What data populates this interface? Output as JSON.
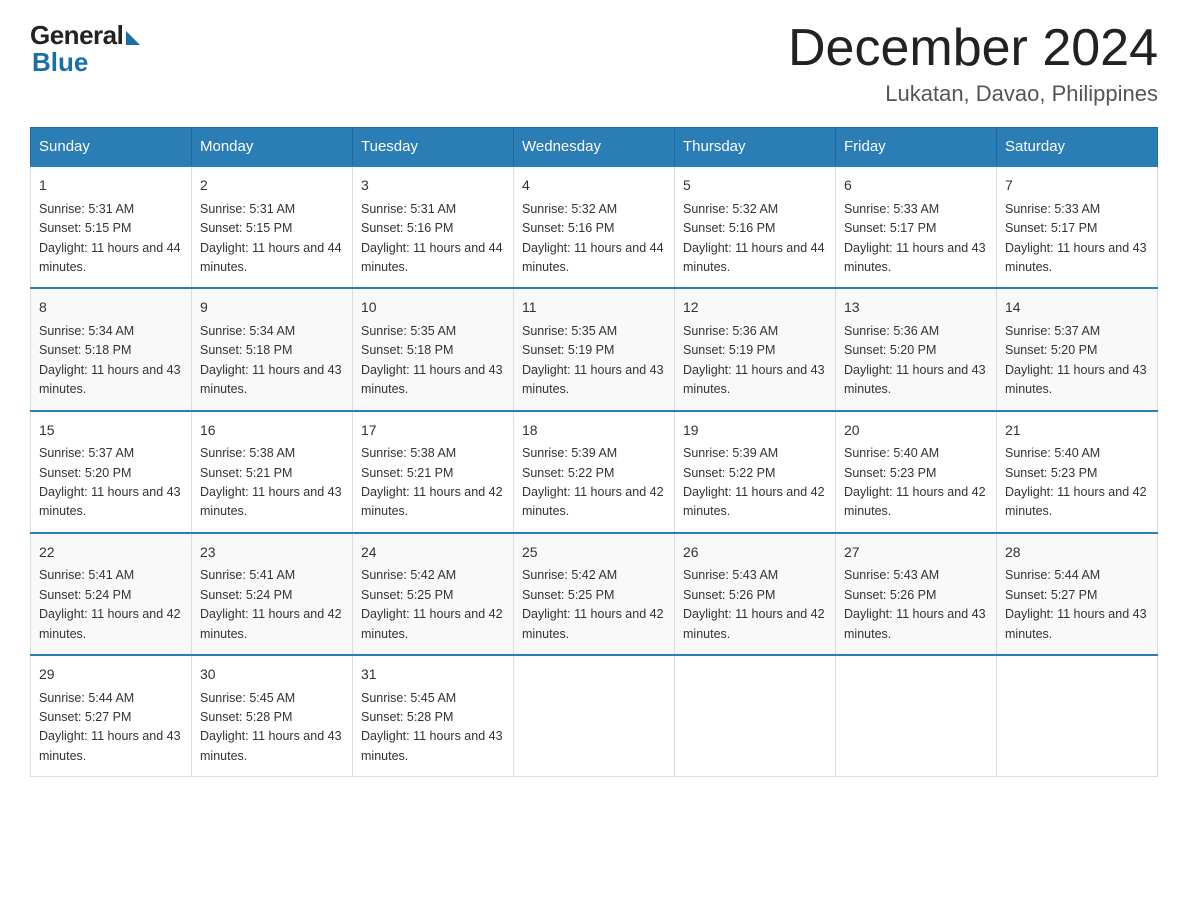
{
  "logo": {
    "general": "General",
    "blue": "Blue"
  },
  "title": "December 2024",
  "subtitle": "Lukatan, Davao, Philippines",
  "headers": [
    "Sunday",
    "Monday",
    "Tuesday",
    "Wednesday",
    "Thursday",
    "Friday",
    "Saturday"
  ],
  "weeks": [
    [
      {
        "day": "1",
        "sunrise": "Sunrise: 5:31 AM",
        "sunset": "Sunset: 5:15 PM",
        "daylight": "Daylight: 11 hours and 44 minutes."
      },
      {
        "day": "2",
        "sunrise": "Sunrise: 5:31 AM",
        "sunset": "Sunset: 5:15 PM",
        "daylight": "Daylight: 11 hours and 44 minutes."
      },
      {
        "day": "3",
        "sunrise": "Sunrise: 5:31 AM",
        "sunset": "Sunset: 5:16 PM",
        "daylight": "Daylight: 11 hours and 44 minutes."
      },
      {
        "day": "4",
        "sunrise": "Sunrise: 5:32 AM",
        "sunset": "Sunset: 5:16 PM",
        "daylight": "Daylight: 11 hours and 44 minutes."
      },
      {
        "day": "5",
        "sunrise": "Sunrise: 5:32 AM",
        "sunset": "Sunset: 5:16 PM",
        "daylight": "Daylight: 11 hours and 44 minutes."
      },
      {
        "day": "6",
        "sunrise": "Sunrise: 5:33 AM",
        "sunset": "Sunset: 5:17 PM",
        "daylight": "Daylight: 11 hours and 43 minutes."
      },
      {
        "day": "7",
        "sunrise": "Sunrise: 5:33 AM",
        "sunset": "Sunset: 5:17 PM",
        "daylight": "Daylight: 11 hours and 43 minutes."
      }
    ],
    [
      {
        "day": "8",
        "sunrise": "Sunrise: 5:34 AM",
        "sunset": "Sunset: 5:18 PM",
        "daylight": "Daylight: 11 hours and 43 minutes."
      },
      {
        "day": "9",
        "sunrise": "Sunrise: 5:34 AM",
        "sunset": "Sunset: 5:18 PM",
        "daylight": "Daylight: 11 hours and 43 minutes."
      },
      {
        "day": "10",
        "sunrise": "Sunrise: 5:35 AM",
        "sunset": "Sunset: 5:18 PM",
        "daylight": "Daylight: 11 hours and 43 minutes."
      },
      {
        "day": "11",
        "sunrise": "Sunrise: 5:35 AM",
        "sunset": "Sunset: 5:19 PM",
        "daylight": "Daylight: 11 hours and 43 minutes."
      },
      {
        "day": "12",
        "sunrise": "Sunrise: 5:36 AM",
        "sunset": "Sunset: 5:19 PM",
        "daylight": "Daylight: 11 hours and 43 minutes."
      },
      {
        "day": "13",
        "sunrise": "Sunrise: 5:36 AM",
        "sunset": "Sunset: 5:20 PM",
        "daylight": "Daylight: 11 hours and 43 minutes."
      },
      {
        "day": "14",
        "sunrise": "Sunrise: 5:37 AM",
        "sunset": "Sunset: 5:20 PM",
        "daylight": "Daylight: 11 hours and 43 minutes."
      }
    ],
    [
      {
        "day": "15",
        "sunrise": "Sunrise: 5:37 AM",
        "sunset": "Sunset: 5:20 PM",
        "daylight": "Daylight: 11 hours and 43 minutes."
      },
      {
        "day": "16",
        "sunrise": "Sunrise: 5:38 AM",
        "sunset": "Sunset: 5:21 PM",
        "daylight": "Daylight: 11 hours and 43 minutes."
      },
      {
        "day": "17",
        "sunrise": "Sunrise: 5:38 AM",
        "sunset": "Sunset: 5:21 PM",
        "daylight": "Daylight: 11 hours and 42 minutes."
      },
      {
        "day": "18",
        "sunrise": "Sunrise: 5:39 AM",
        "sunset": "Sunset: 5:22 PM",
        "daylight": "Daylight: 11 hours and 42 minutes."
      },
      {
        "day": "19",
        "sunrise": "Sunrise: 5:39 AM",
        "sunset": "Sunset: 5:22 PM",
        "daylight": "Daylight: 11 hours and 42 minutes."
      },
      {
        "day": "20",
        "sunrise": "Sunrise: 5:40 AM",
        "sunset": "Sunset: 5:23 PM",
        "daylight": "Daylight: 11 hours and 42 minutes."
      },
      {
        "day": "21",
        "sunrise": "Sunrise: 5:40 AM",
        "sunset": "Sunset: 5:23 PM",
        "daylight": "Daylight: 11 hours and 42 minutes."
      }
    ],
    [
      {
        "day": "22",
        "sunrise": "Sunrise: 5:41 AM",
        "sunset": "Sunset: 5:24 PM",
        "daylight": "Daylight: 11 hours and 42 minutes."
      },
      {
        "day": "23",
        "sunrise": "Sunrise: 5:41 AM",
        "sunset": "Sunset: 5:24 PM",
        "daylight": "Daylight: 11 hours and 42 minutes."
      },
      {
        "day": "24",
        "sunrise": "Sunrise: 5:42 AM",
        "sunset": "Sunset: 5:25 PM",
        "daylight": "Daylight: 11 hours and 42 minutes."
      },
      {
        "day": "25",
        "sunrise": "Sunrise: 5:42 AM",
        "sunset": "Sunset: 5:25 PM",
        "daylight": "Daylight: 11 hours and 42 minutes."
      },
      {
        "day": "26",
        "sunrise": "Sunrise: 5:43 AM",
        "sunset": "Sunset: 5:26 PM",
        "daylight": "Daylight: 11 hours and 42 minutes."
      },
      {
        "day": "27",
        "sunrise": "Sunrise: 5:43 AM",
        "sunset": "Sunset: 5:26 PM",
        "daylight": "Daylight: 11 hours and 43 minutes."
      },
      {
        "day": "28",
        "sunrise": "Sunrise: 5:44 AM",
        "sunset": "Sunset: 5:27 PM",
        "daylight": "Daylight: 11 hours and 43 minutes."
      }
    ],
    [
      {
        "day": "29",
        "sunrise": "Sunrise: 5:44 AM",
        "sunset": "Sunset: 5:27 PM",
        "daylight": "Daylight: 11 hours and 43 minutes."
      },
      {
        "day": "30",
        "sunrise": "Sunrise: 5:45 AM",
        "sunset": "Sunset: 5:28 PM",
        "daylight": "Daylight: 11 hours and 43 minutes."
      },
      {
        "day": "31",
        "sunrise": "Sunrise: 5:45 AM",
        "sunset": "Sunset: 5:28 PM",
        "daylight": "Daylight: 11 hours and 43 minutes."
      },
      null,
      null,
      null,
      null
    ]
  ]
}
